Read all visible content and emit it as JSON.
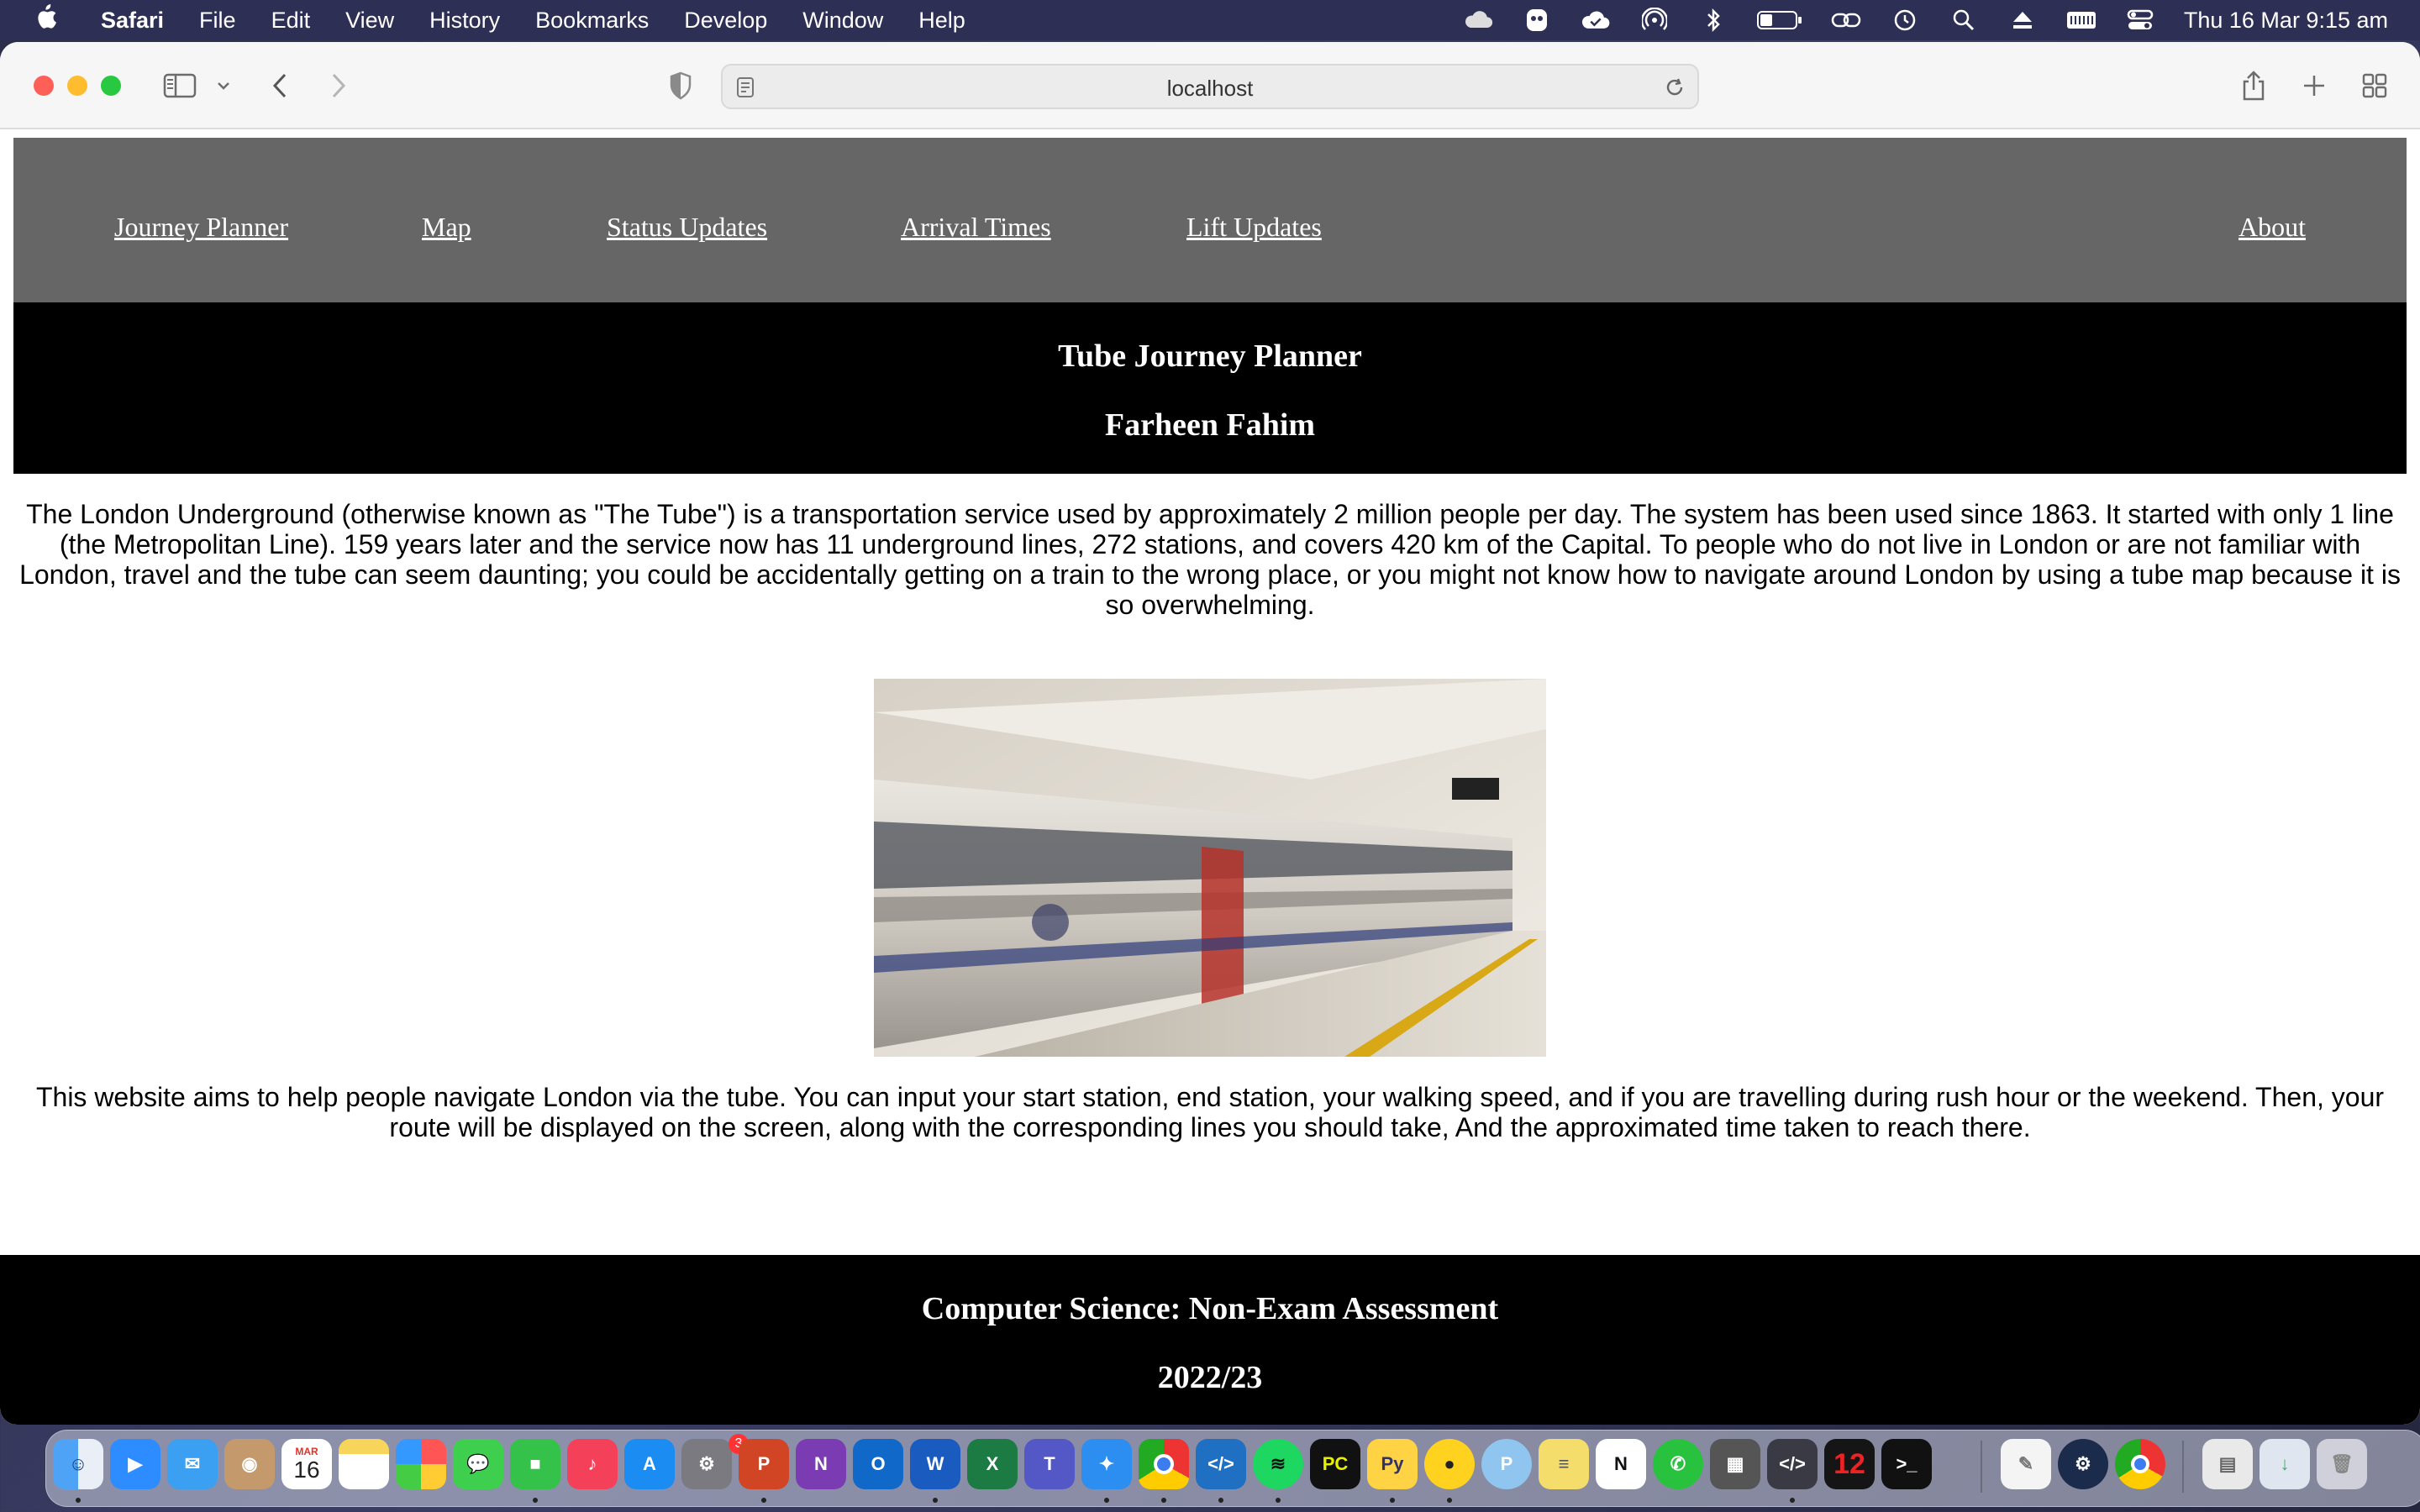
{
  "menubar": {
    "app_name": "Safari",
    "menus": [
      "File",
      "Edit",
      "View",
      "History",
      "Bookmarks",
      "Develop",
      "Window",
      "Help"
    ],
    "clock": "Thu 16 Mar  9:15 am",
    "status_icons": [
      "cloud-icon",
      "ghost-icon",
      "check-cloud-icon",
      "airdrop-icon",
      "bluetooth-icon",
      "battery-icon",
      "link-icon",
      "time-machine-icon",
      "spotlight-icon",
      "eject-icon",
      "keyboard-icon",
      "control-center-icon"
    ]
  },
  "browser": {
    "url": "localhost"
  },
  "nav": {
    "items": [
      "Journey Planner",
      "Map",
      "Status Updates",
      "Arrival Times",
      "Lift Updates"
    ],
    "about": "About"
  },
  "hero": {
    "title": "Tube Journey Planner",
    "author": "Farheen Fahim"
  },
  "content": {
    "intro": "The London Underground (otherwise known as \"The Tube\") is a transportation service used by approximately 2 million people per day. The system has been used since 1863. It started with only 1 line (the Metropolitan Line). 159 years later and the service now has 11 underground lines, 272 stations, and covers 420 km of the Capital. To people who do not live in London or are not familiar with London, travel and the tube can seem daunting; you could be accidentally getting on a train to the wrong place, or you might not know how to navigate around London by using a tube map because it is so overwhelming.",
    "aim": "This website aims to help people navigate London via the tube. You can input your start station, end station, your walking speed, and if you are travelling during rush hour or the weekend. Then, your route will be displayed on the screen, along with the corresponding lines you should take, And the approximated time taken to reach there."
  },
  "footer": {
    "course": "Computer Science: Non-Exam Assessment",
    "year": "2022/23"
  },
  "dock": {
    "calendar_month": "MAR",
    "calendar_day": "16",
    "badge_count": "3",
    "apps": [
      "finder",
      "zoom",
      "mail",
      "contacts",
      "notes",
      "photos",
      "messages",
      "facetime",
      "music",
      "app-store",
      "system-settings",
      "powerpoint",
      "onenote",
      "outlook",
      "word",
      "excel",
      "teams",
      "safari",
      "chrome",
      "vscode",
      "spotify",
      "pycharm",
      "python",
      "cyberghost",
      "proton",
      "stickies",
      "notion",
      "whatsapp",
      "calculator",
      "script-editor",
      "clock",
      "terminal",
      "textedit",
      "steam",
      "chrome-2",
      "preview",
      "downloads",
      "trash"
    ]
  }
}
